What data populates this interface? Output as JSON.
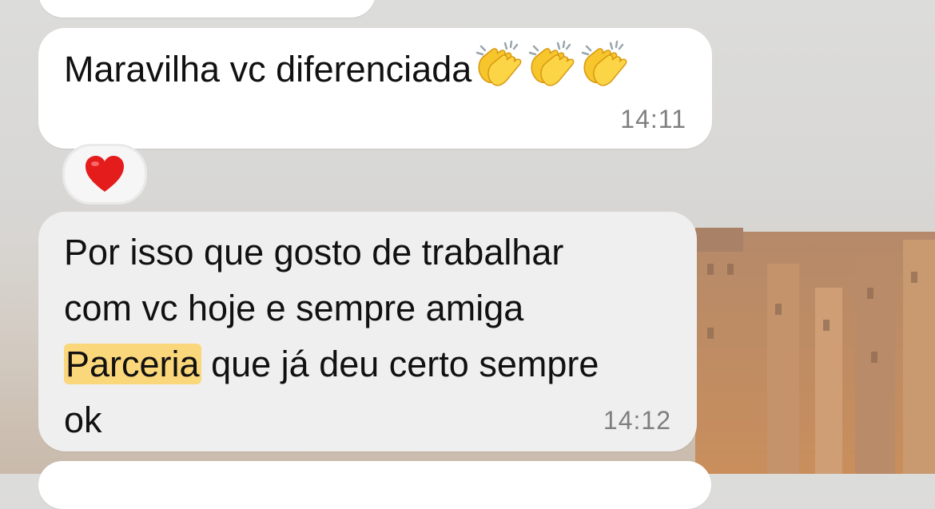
{
  "messages": [
    {
      "text": "Maravilha vc diferenciada",
      "emoji": "👏👏👏",
      "time": "14:11",
      "reaction": "❤️"
    },
    {
      "line1": "Por isso que gosto de trabalhar",
      "line2": "com vc hoje e sempre amiga",
      "highlighted_word": "Parceria",
      "line3_rest": " que já deu certo sempre",
      "line4": "ok",
      "time": "14:12"
    }
  ],
  "colors": {
    "incoming_bubble": "#ffffff",
    "selected_bubble": "#efefef",
    "highlight": "#fbd77c",
    "timestamp": "#7f7f7f"
  }
}
